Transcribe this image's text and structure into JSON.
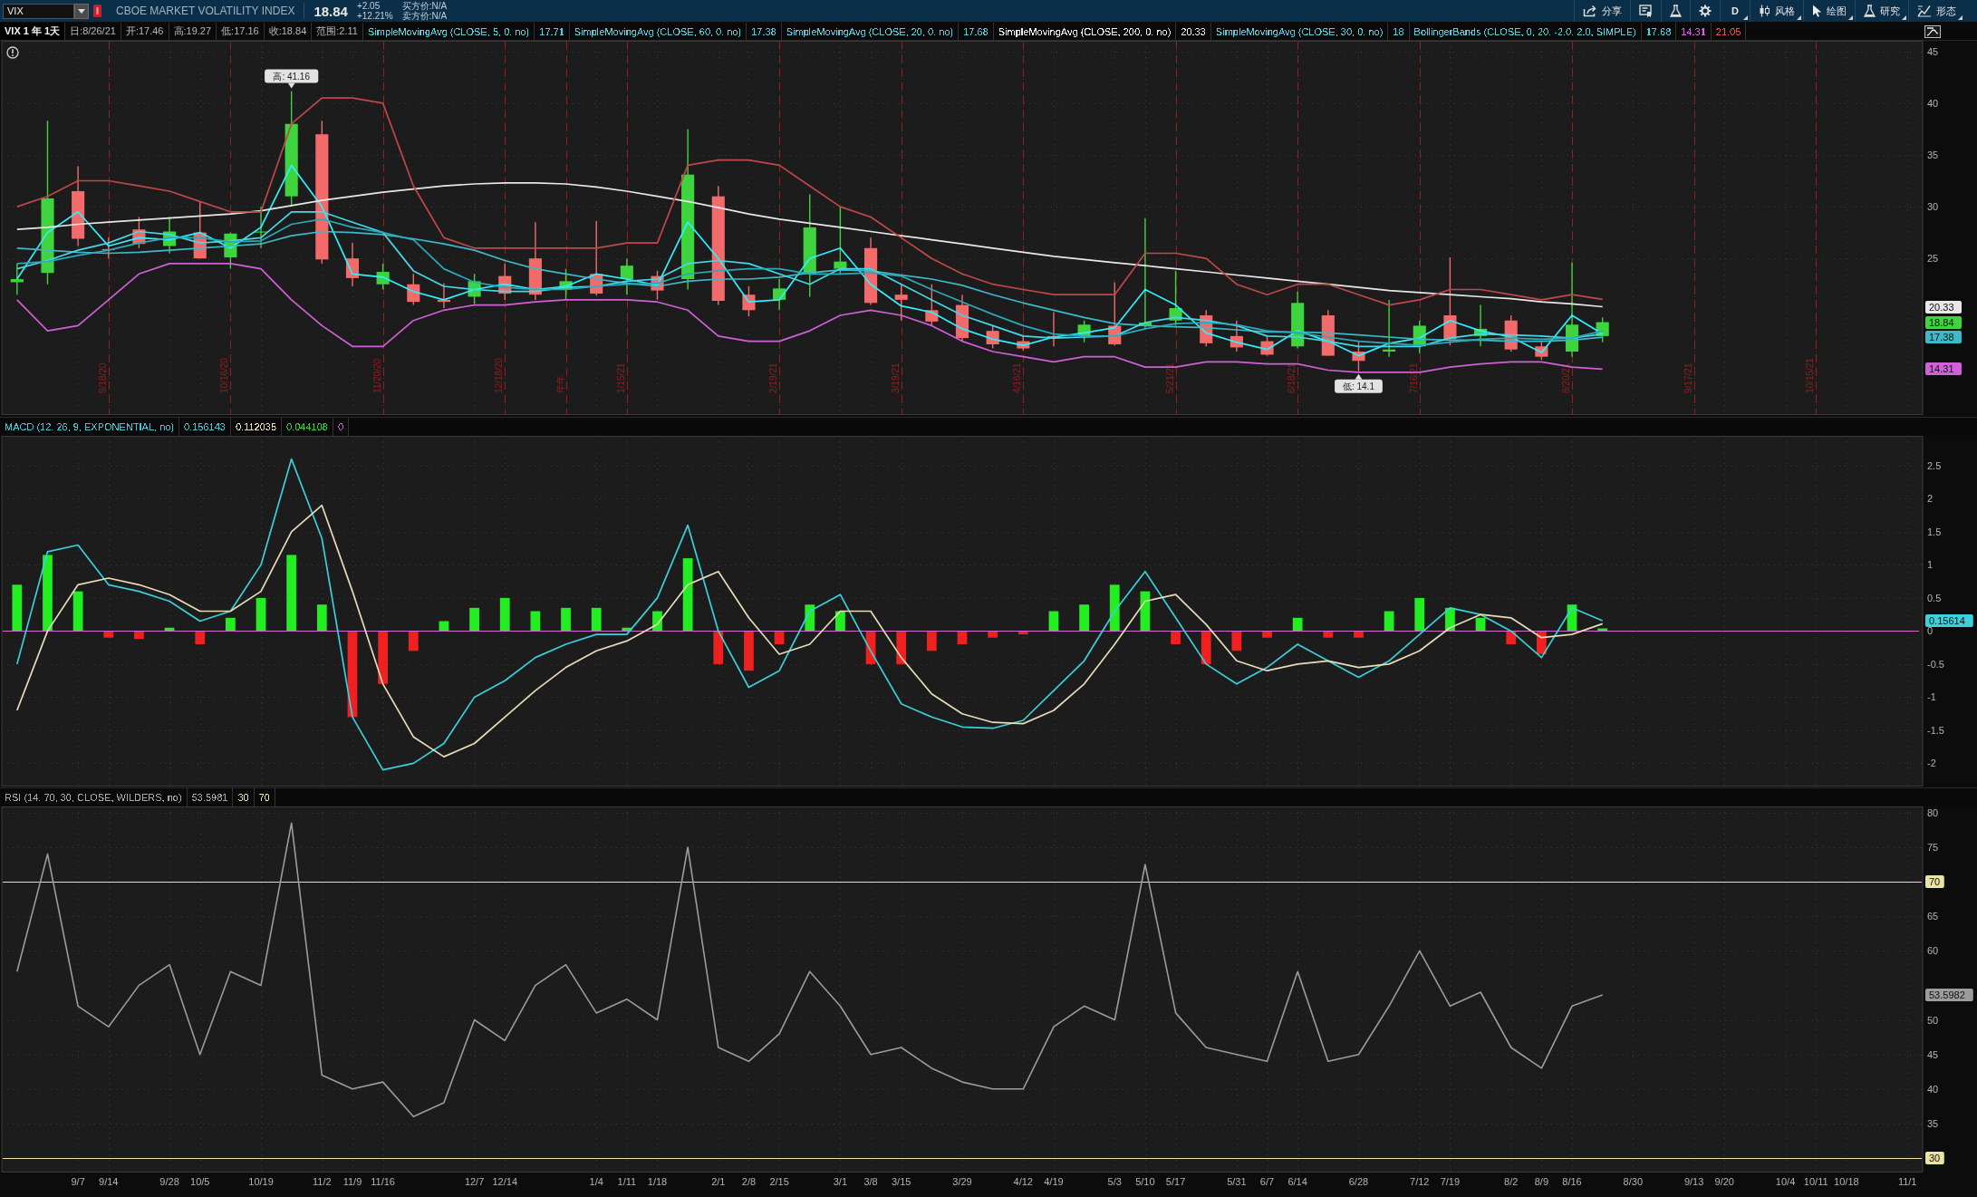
{
  "top_bar": {
    "symbol": "VIX",
    "description": "CBOE MARKET VOLATILITY INDEX",
    "last": "18.84",
    "change": "+2.05",
    "change_percent": "+12.21%",
    "bid": "买方价:N/A",
    "ask": "卖方价:N/A",
    "tools": [
      {
        "kind": "share",
        "label": "分享",
        "dropdown": false
      },
      {
        "kind": "sheet",
        "dropdown": false
      },
      {
        "kind": "flask",
        "dropdown": false
      },
      {
        "kind": "gear",
        "dropdown": false
      },
      {
        "kind": "text",
        "label": "D",
        "dropdown": true
      },
      {
        "kind": "candles",
        "label": "风格",
        "dropdown": true
      },
      {
        "kind": "cursor",
        "label": "绘图",
        "dropdown": true
      },
      {
        "kind": "flask",
        "label": "研究",
        "dropdown": true
      },
      {
        "kind": "pattern",
        "label": "形态",
        "dropdown": true
      }
    ]
  },
  "price_panel": {
    "header": {
      "title": "VIX 1 年 1天",
      "quote": [
        "日:8/26/21",
        "开:17.46",
        "高:19.27",
        "低:17.16",
        "收:18.84",
        "范围:2.11"
      ],
      "studies": [
        {
          "label": "SimpleMovingAvg (CLOSE, 5, 0, no)",
          "color": "#4cd3df",
          "values": [
            {
              "text": "17.71",
              "color": "#4cd3df"
            }
          ]
        },
        {
          "label": "SimpleMovingAvg (CLOSE, 60, 0, no)",
          "color": "#4cd3df",
          "values": [
            {
              "text": "17.38",
              "color": "#4cd3df"
            }
          ]
        },
        {
          "label": "SimpleMovingAvg (CLOSE, 20, 0, no)",
          "color": "#4cd3df",
          "values": [
            {
              "text": "17.68",
              "color": "#4cd3df"
            }
          ]
        },
        {
          "label": "SimpleMovingAvg (CLOSE, 200, 0, no)",
          "color": "#f0f0f0",
          "values": [
            {
              "text": "20.33",
              "color": "#f0f0f0"
            }
          ]
        },
        {
          "label": "SimpleMovingAvg (CLOSE, 30, 0, no)",
          "color": "#4cd3df",
          "values": [
            {
              "text": "18",
              "color": "#4cd3df"
            }
          ]
        },
        {
          "label": "BollingerBands (CLOSE, 0, 20, -2.0, 2.0, SIMPLE)",
          "color": "#4cd3df",
          "values": [
            {
              "text": "17.68",
              "color": "#4cd3df"
            },
            {
              "text": "14.31",
              "color": "#e060e0"
            },
            {
              "text": "21.05",
              "color": "#f05050"
            }
          ]
        }
      ]
    },
    "chart_data": {
      "type": "candlestick",
      "grid": true,
      "ylim": [
        9.87,
        46.03
      ],
      "yticks": [
        25,
        30,
        35,
        40,
        45,
        {
          "value": 20.33,
          "label": "20.33"
        },
        {
          "value": 18.84,
          "label": "18.84"
        },
        {
          "value": 17.38,
          "label": "17.38"
        },
        {
          "value": 14.31,
          "label": "14.31"
        }
      ],
      "categories": [
        null,
        null,
        null,
        "9/18/20",
        null,
        null,
        null,
        "10/16/20",
        null,
        null,
        null,
        null,
        "11/20/20",
        null,
        null,
        null,
        "12/18/20",
        null,
        "年年",
        null,
        "1/15/21",
        null,
        null,
        null,
        null,
        "2/19/21",
        null,
        null,
        null,
        "3/19/21",
        null,
        null,
        null,
        "4/16/21",
        null,
        null,
        null,
        null,
        "5/21/21",
        null,
        null,
        null,
        "6/18/21",
        null,
        null,
        null,
        "7/16/21",
        null,
        null,
        null,
        null,
        "8/20/21",
        null,
        null,
        null,
        "9/17/21",
        null,
        null,
        null,
        "10/15/21",
        null,
        null,
        null
      ],
      "ohlc": [
        [
          22.7,
          24.5,
          21.5,
          23.0
        ],
        [
          23.6,
          38.3,
          22.5,
          30.8
        ],
        [
          31.5,
          33.9,
          26.2,
          26.9
        ],
        [
          25.9,
          27.0,
          25.0,
          25.8
        ],
        [
          27.8,
          29.0,
          26.0,
          26.4
        ],
        [
          26.2,
          29.0,
          25.5,
          27.6
        ],
        [
          27.5,
          30.5,
          25.0,
          25.0
        ],
        [
          25.1,
          27.5,
          24.0,
          27.4
        ],
        [
          27.5,
          30.0,
          26.0,
          27.6
        ],
        [
          31.0,
          41.16,
          30.0,
          38.0
        ],
        [
          37.0,
          38.3,
          24.5,
          24.9
        ],
        [
          25.0,
          26.5,
          22.3,
          23.1
        ],
        [
          22.5,
          24.5,
          22.0,
          23.7
        ],
        [
          22.5,
          23.5,
          20.5,
          20.8
        ],
        [
          21.0,
          22.6,
          20.2,
          20.8
        ],
        [
          21.3,
          23.5,
          20.6,
          22.8
        ],
        [
          23.3,
          24.5,
          21.0,
          21.6
        ],
        [
          25.0,
          28.5,
          21.0,
          21.5
        ],
        [
          22.0,
          24.0,
          21.0,
          22.8
        ],
        [
          23.5,
          28.6,
          21.4,
          21.6
        ],
        [
          23.0,
          25.0,
          21.5,
          24.3
        ],
        [
          23.3,
          23.8,
          21.0,
          21.9
        ],
        [
          23.0,
          37.5,
          22.0,
          33.1
        ],
        [
          31.0,
          32.0,
          20.5,
          20.9
        ],
        [
          21.5,
          22.3,
          19.4,
          20.0
        ],
        [
          21.0,
          23.0,
          20.0,
          22.1
        ],
        [
          23.5,
          31.2,
          21.3,
          28.0
        ],
        [
          24.0,
          30.0,
          23.5,
          24.7
        ],
        [
          26.0,
          27.0,
          20.5,
          20.7
        ],
        [
          21.5,
          22.5,
          19.0,
          21.0
        ],
        [
          20.0,
          22.5,
          18.5,
          18.9
        ],
        [
          20.5,
          21.5,
          17.0,
          17.3
        ],
        [
          18.0,
          18.5,
          16.3,
          16.7
        ],
        [
          17.0,
          17.5,
          16.1,
          16.3
        ],
        [
          17.5,
          19.8,
          16.5,
          17.3
        ],
        [
          17.5,
          19.0,
          16.9,
          18.6
        ],
        [
          18.5,
          22.7,
          16.6,
          16.7
        ],
        [
          18.5,
          28.9,
          18.2,
          18.8
        ],
        [
          19.0,
          23.8,
          18.5,
          20.2
        ],
        [
          19.5,
          20.0,
          16.5,
          16.8
        ],
        [
          17.5,
          19.0,
          16.0,
          16.4
        ],
        [
          17.0,
          17.5,
          15.6,
          15.7
        ],
        [
          16.5,
          21.8,
          16.3,
          20.7
        ],
        [
          19.5,
          20.0,
          15.6,
          15.6
        ],
        [
          16.0,
          17.0,
          14.1,
          15.1
        ],
        [
          16.0,
          21.0,
          15.5,
          16.2
        ],
        [
          16.5,
          19.0,
          15.8,
          18.5
        ],
        [
          19.5,
          25.1,
          16.6,
          17.2
        ],
        [
          17.5,
          20.5,
          16.5,
          18.2
        ],
        [
          19.0,
          19.5,
          16.0,
          16.2
        ],
        [
          16.5,
          17.0,
          15.2,
          15.5
        ],
        [
          16.0,
          24.6,
          15.5,
          18.6
        ],
        [
          17.5,
          19.3,
          16.9,
          18.84
        ],
        null,
        null,
        null,
        null,
        null,
        null,
        null,
        null,
        null,
        null
      ],
      "series": [
        {
          "type": "line",
          "color": "#2ff0ff",
          "values": [
            23.0,
            27.5,
            29.5,
            26.2,
            27.0,
            26.8,
            27.5,
            26.0,
            28.0,
            34.0,
            30.0,
            23.5,
            23.2,
            21.8,
            21.0,
            22.0,
            22.5,
            22.0,
            22.3,
            23.5,
            23.0,
            22.4,
            28.5,
            25.0,
            20.8,
            21.0,
            25.0,
            26.0,
            22.5,
            20.4,
            19.8,
            18.2,
            17.2,
            16.6,
            17.4,
            17.8,
            18.3,
            22.0,
            20.5,
            17.8,
            16.9,
            16.2,
            18.0,
            17.0,
            15.6,
            16.8,
            17.3,
            19.0,
            18.0,
            17.4,
            15.9,
            19.5,
            17.7,
            null,
            null,
            null,
            null,
            null,
            null,
            null,
            null,
            null,
            null
          ]
        },
        {
          "type": "line",
          "color": "#3fb8c8",
          "values": [
            26.0,
            25.8,
            25.6,
            25.5,
            25.6,
            25.8,
            26.0,
            26.2,
            26.4,
            27.2,
            27.6,
            27.5,
            27.3,
            26.9,
            26.4,
            25.8,
            24.8,
            24.0,
            23.5,
            23.0,
            22.6,
            22.3,
            22.8,
            23.0,
            23.0,
            23.2,
            23.6,
            23.9,
            23.8,
            23.4,
            23.0,
            22.4,
            21.5,
            20.7,
            20.0,
            19.3,
            18.7,
            18.5,
            18.4,
            18.3,
            18.1,
            17.9,
            17.9,
            17.8,
            17.6,
            17.4,
            17.2,
            17.1,
            17.1,
            17.0,
            17.0,
            17.1,
            17.38,
            null,
            null,
            null,
            null,
            null,
            null,
            null,
            null,
            null,
            null
          ]
        },
        {
          "type": "line",
          "color": "#46d8e6",
          "values": [
            24.0,
            24.8,
            25.8,
            26.5,
            27.6,
            27.3,
            26.5,
            26.7,
            27.0,
            29.5,
            29.5,
            28.5,
            27.5,
            23.8,
            22.3,
            22.0,
            21.8,
            21.8,
            22.2,
            22.3,
            22.8,
            23.0,
            24.5,
            24.8,
            24.5,
            23.5,
            22.5,
            24.0,
            24.0,
            22.5,
            21.0,
            19.5,
            18.5,
            17.5,
            17.3,
            17.4,
            17.5,
            18.8,
            19.3,
            19.0,
            18.5,
            17.5,
            17.4,
            17.0,
            16.5,
            16.5,
            16.5,
            17.3,
            17.7,
            17.6,
            17.5,
            17.3,
            17.7,
            null,
            null,
            null,
            null,
            null,
            null,
            null,
            null,
            null,
            null
          ]
        },
        {
          "type": "line",
          "color": "#e8e8e8",
          "values": [
            27.8,
            28.0,
            28.3,
            28.5,
            28.7,
            28.9,
            29.1,
            29.3,
            29.6,
            30.1,
            30.6,
            31.0,
            31.4,
            31.7,
            32.0,
            32.2,
            32.3,
            32.3,
            32.2,
            31.9,
            31.5,
            31.0,
            30.5,
            29.9,
            29.3,
            28.8,
            28.4,
            28.0,
            27.6,
            27.2,
            26.8,
            26.4,
            26.0,
            25.6,
            25.2,
            24.9,
            24.6,
            24.3,
            24.0,
            23.7,
            23.4,
            23.1,
            22.8,
            22.5,
            22.2,
            21.9,
            21.7,
            21.5,
            21.3,
            21.1,
            20.8,
            20.6,
            20.33,
            null,
            null,
            null,
            null,
            null,
            null,
            null,
            null,
            null,
            null
          ]
        },
        {
          "type": "line",
          "color": "#2aa9b8",
          "values": [
            24.5,
            24.7,
            25.3,
            25.8,
            26.5,
            27.0,
            27.0,
            26.6,
            26.7,
            28.3,
            28.8,
            28.0,
            27.5,
            26.8,
            24.0,
            22.7,
            22.2,
            22.0,
            22.0,
            22.3,
            22.5,
            22.6,
            23.5,
            23.8,
            24.0,
            24.0,
            23.5,
            23.5,
            23.6,
            23.3,
            22.0,
            20.8,
            19.6,
            18.5,
            17.7,
            17.5,
            17.5,
            18.2,
            18.7,
            18.8,
            18.6,
            18.0,
            17.8,
            17.4,
            17.0,
            16.8,
            16.6,
            16.9,
            17.2,
            17.3,
            17.2,
            17.3,
            18.0,
            null,
            null,
            null,
            null,
            null,
            null,
            null,
            null,
            null,
            null
          ]
        },
        {
          "type": "line",
          "color": "#d060d8",
          "values": [
            21.0,
            18.0,
            18.5,
            21.0,
            23.5,
            24.5,
            24.5,
            24.5,
            24.0,
            21.0,
            18.5,
            16.5,
            16.5,
            19.0,
            20.0,
            20.5,
            20.5,
            20.8,
            21.0,
            21.0,
            21.0,
            20.8,
            20.0,
            17.5,
            17.0,
            17.0,
            18.0,
            19.5,
            20.0,
            19.5,
            18.5,
            17.0,
            16.0,
            15.5,
            15.0,
            15.5,
            15.5,
            14.5,
            14.5,
            15.0,
            15.0,
            14.8,
            14.8,
            14.2,
            14.0,
            14.0,
            14.0,
            14.5,
            14.8,
            15.0,
            15.0,
            14.5,
            14.31,
            null,
            null,
            null,
            null,
            null,
            null,
            null,
            null,
            null,
            null
          ]
        },
        {
          "type": "line",
          "color": "#c04848",
          "values": [
            30.0,
            31.0,
            32.5,
            32.5,
            32.0,
            31.5,
            30.5,
            29.5,
            29.5,
            38.0,
            40.5,
            40.5,
            40.0,
            32.0,
            27.0,
            26.0,
            26.0,
            26.0,
            26.0,
            26.0,
            26.5,
            26.5,
            34.0,
            34.5,
            34.5,
            34.0,
            32.0,
            30.0,
            29.0,
            27.0,
            25.0,
            23.5,
            22.5,
            22.0,
            21.5,
            21.5,
            21.5,
            25.5,
            25.5,
            25.0,
            22.5,
            21.5,
            22.5,
            22.5,
            21.5,
            20.5,
            21.0,
            22.0,
            22.0,
            21.5,
            21.0,
            21.5,
            21.05,
            null,
            null,
            null,
            null,
            null,
            null,
            null,
            null,
            null,
            null
          ]
        }
      ],
      "annotations": [
        {
          "y": 41.16,
          "text": "高: 41.16"
        },
        {
          "y": 14.1,
          "text": "低: 14.1"
        }
      ]
    }
  },
  "macd_panel": {
    "header": {
      "studies": [
        {
          "label": "MACD (12, 26, 9, EXPONENTIAL, no)",
          "color": "#3fc9d6",
          "values": [
            {
              "text": "0.156143",
              "color": "#3fc9d6"
            },
            {
              "text": "0.112035",
              "color": "#e6dcc2"
            },
            {
              "text": "0.044108",
              "color": "#2fd82f"
            },
            {
              "text": "0",
              "color": "#c86cc0"
            }
          ]
        }
      ]
    },
    "chart_data": {
      "type": "line",
      "grid": true,
      "ylim": [
        -2.35,
        2.95
      ],
      "yticks": [
        2.5,
        2,
        1.5,
        1,
        0.5,
        0,
        -0.5,
        -1,
        -1.5,
        -2,
        {
          "value": 0.15614,
          "label": "0.15614"
        }
      ],
      "categories": [
        null,
        null,
        null,
        null,
        null,
        null,
        null,
        null,
        null,
        null,
        null,
        null,
        null,
        null,
        null,
        null,
        null,
        null,
        null,
        null,
        null,
        null,
        null,
        null,
        null,
        null,
        null,
        null,
        null,
        null,
        null,
        null,
        null,
        null,
        null,
        null,
        null,
        null,
        null,
        null,
        null,
        null,
        null,
        null,
        null,
        null,
        null,
        null,
        null,
        null,
        null,
        null,
        null,
        null,
        null,
        null,
        null,
        null,
        null,
        null,
        null,
        null,
        null
      ],
      "series": [
        {
          "type": "bar",
          "color": "#22ee22",
          "values": [
            0.7,
            1.15,
            0.6,
            null,
            null,
            0.05,
            null,
            0.2,
            0.5,
            1.15,
            0.4,
            null,
            null,
            null,
            0.15,
            0.35,
            0.5,
            0.3,
            0.35,
            0.35,
            0.05,
            0.3,
            1.1,
            null,
            null,
            null,
            0.4,
            0.3,
            null,
            null,
            null,
            null,
            null,
            null,
            0.3,
            0.4,
            0.7,
            0.6,
            null,
            null,
            null,
            null,
            0.2,
            null,
            null,
            0.3,
            0.5,
            0.35,
            0.2,
            null,
            null,
            0.4,
            0.04,
            null,
            null,
            null,
            null,
            null,
            null,
            null,
            null,
            null,
            null
          ]
        },
        {
          "type": "bar",
          "color": "#ee2020",
          "values": [
            null,
            null,
            null,
            -0.1,
            -0.12,
            null,
            -0.2,
            null,
            null,
            null,
            null,
            -1.3,
            -0.8,
            -0.3,
            null,
            null,
            null,
            null,
            null,
            null,
            null,
            null,
            null,
            -0.5,
            -0.6,
            -0.2,
            null,
            null,
            -0.5,
            -0.5,
            -0.3,
            -0.2,
            -0.1,
            -0.05,
            null,
            null,
            null,
            null,
            -0.2,
            -0.5,
            -0.3,
            -0.1,
            null,
            -0.1,
            -0.1,
            null,
            null,
            null,
            null,
            -0.2,
            -0.35,
            null,
            null,
            null,
            null,
            null,
            null,
            null,
            null,
            null,
            null,
            null,
            null
          ]
        },
        {
          "color": "#3ad0dc",
          "values": [
            -0.5,
            1.2,
            1.3,
            0.7,
            0.6,
            0.45,
            0.15,
            0.3,
            1.0,
            2.6,
            1.4,
            -1.3,
            -2.1,
            -2.0,
            -1.7,
            -1.0,
            -0.75,
            -0.4,
            -0.2,
            -0.05,
            -0.05,
            0.5,
            1.6,
            0.0,
            -0.85,
            -0.6,
            0.3,
            0.55,
            -0.3,
            -1.1,
            -1.3,
            -1.45,
            -1.47,
            -1.35,
            -0.9,
            -0.45,
            0.3,
            0.9,
            0.2,
            -0.5,
            -0.8,
            -0.55,
            -0.2,
            -0.45,
            -0.7,
            -0.45,
            -0.05,
            0.35,
            0.25,
            0.0,
            -0.4,
            0.35,
            0.15614,
            null,
            null,
            null,
            null,
            null,
            null,
            null,
            null,
            null,
            null
          ]
        },
        {
          "color": "#e8dcb8",
          "values": [
            -1.2,
            0.0,
            0.7,
            0.8,
            0.7,
            0.55,
            0.3,
            0.3,
            0.6,
            1.5,
            1.9,
            0.6,
            -0.8,
            -1.6,
            -1.9,
            -1.7,
            -1.3,
            -0.9,
            -0.55,
            -0.3,
            -0.15,
            0.1,
            0.7,
            0.9,
            0.2,
            -0.35,
            -0.2,
            0.3,
            0.3,
            -0.4,
            -0.95,
            -1.25,
            -1.38,
            -1.4,
            -1.2,
            -0.8,
            -0.2,
            0.45,
            0.55,
            0.1,
            -0.45,
            -0.6,
            -0.5,
            -0.45,
            -0.55,
            -0.5,
            -0.3,
            0.05,
            0.25,
            0.2,
            -0.1,
            -0.05,
            0.11,
            null,
            null,
            null,
            null,
            null,
            null,
            null,
            null,
            null,
            null
          ]
        }
      ],
      "ref_lines": [
        {
          "axis": "y",
          "value": 0,
          "color": "#d06ad0"
        }
      ]
    }
  },
  "rsi_panel": {
    "header": {
      "studies": [
        {
          "label": "RSI (14, 70, 30, CLOSE, WILDERS, no)",
          "color": "#a8a8a8",
          "values": [
            {
              "text": "53.5981",
              "color": "#a8a8a8"
            },
            {
              "text": "30",
              "color": "#ebe2b0"
            },
            {
              "text": "70",
              "color": "#ebe2b0"
            }
          ]
        }
      ]
    },
    "chart_data": {
      "type": "line",
      "grid": true,
      "ylim": [
        27.9,
        80.9
      ],
      "yticks": [
        80,
        75,
        65,
        60,
        50,
        45,
        40,
        35,
        {
          "value": 53.5982,
          "label": "53.5982"
        }
      ],
      "categories": [
        null,
        null,
        "9/7",
        "9/14",
        null,
        "9/28",
        "10/5",
        null,
        "10/19",
        null,
        "11/2",
        "11/9",
        "11/16",
        null,
        null,
        "12/7",
        "12/14",
        null,
        null,
        "1/4",
        "1/11",
        "1/18",
        null,
        "2/1",
        "2/8",
        "2/15",
        null,
        "3/1",
        "3/8",
        "3/15",
        null,
        "3/29",
        null,
        "4/12",
        "4/19",
        null,
        "5/3",
        "5/10",
        "5/17",
        null,
        "5/31",
        "6/7",
        "6/14",
        null,
        "6/28",
        null,
        "7/12",
        "7/19",
        null,
        "8/2",
        "8/9",
        "8/16",
        null,
        "8/30",
        null,
        "9/13",
        "9/20",
        null,
        "10/4",
        "10/11",
        "10/18",
        null,
        "11/1"
      ],
      "series": [
        {
          "color": "#9c9c9c",
          "values": [
            57,
            74,
            52,
            49,
            55,
            58,
            45,
            57,
            55,
            78.5,
            42,
            40,
            41,
            36,
            38,
            50,
            47,
            55,
            58,
            51,
            53,
            50,
            75,
            46,
            44,
            48,
            57,
            52,
            45,
            46,
            43,
            41,
            40,
            40,
            49,
            52,
            50,
            72.5,
            51,
            46,
            45,
            44,
            57,
            44,
            45,
            52,
            60,
            52,
            54,
            46,
            43,
            52,
            53.5982,
            null,
            null,
            null,
            null,
            null,
            null,
            null,
            null,
            null,
            null
          ]
        }
      ],
      "ref_lines": [
        {
          "axis": "y",
          "value": 70,
          "label": "70",
          "color": "#ebe2a6"
        },
        {
          "axis": "y",
          "value": 30,
          "label": "30",
          "color": "#ebe2a6"
        }
      ]
    }
  }
}
